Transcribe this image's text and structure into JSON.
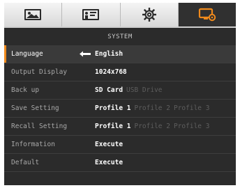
{
  "tabs": [
    {
      "icon": "image-icon",
      "active": false
    },
    {
      "icon": "presentation-icon",
      "active": false
    },
    {
      "icon": "gear-icon",
      "active": false
    },
    {
      "icon": "monitor-settings-icon",
      "active": true
    }
  ],
  "section_title": "SYSTEM",
  "accent_color": "#f08a1c",
  "menu": {
    "language": {
      "label": "Language",
      "value": "English"
    },
    "output_display": {
      "label": "Output Display",
      "value": "1024x768"
    },
    "back_up": {
      "label": "Back up",
      "options": [
        "SD Card",
        "USB Drive"
      ]
    },
    "save_setting": {
      "label": "Save Setting",
      "options": [
        "Profile 1",
        "Profile 2",
        "Profile 3"
      ]
    },
    "recall_setting": {
      "label": "Recall Setting",
      "options": [
        "Profile 1",
        "Profile 2",
        "Profile 3"
      ]
    },
    "information": {
      "label": "Information",
      "value": "Execute"
    },
    "default": {
      "label": "Default",
      "value": "Execute"
    }
  }
}
